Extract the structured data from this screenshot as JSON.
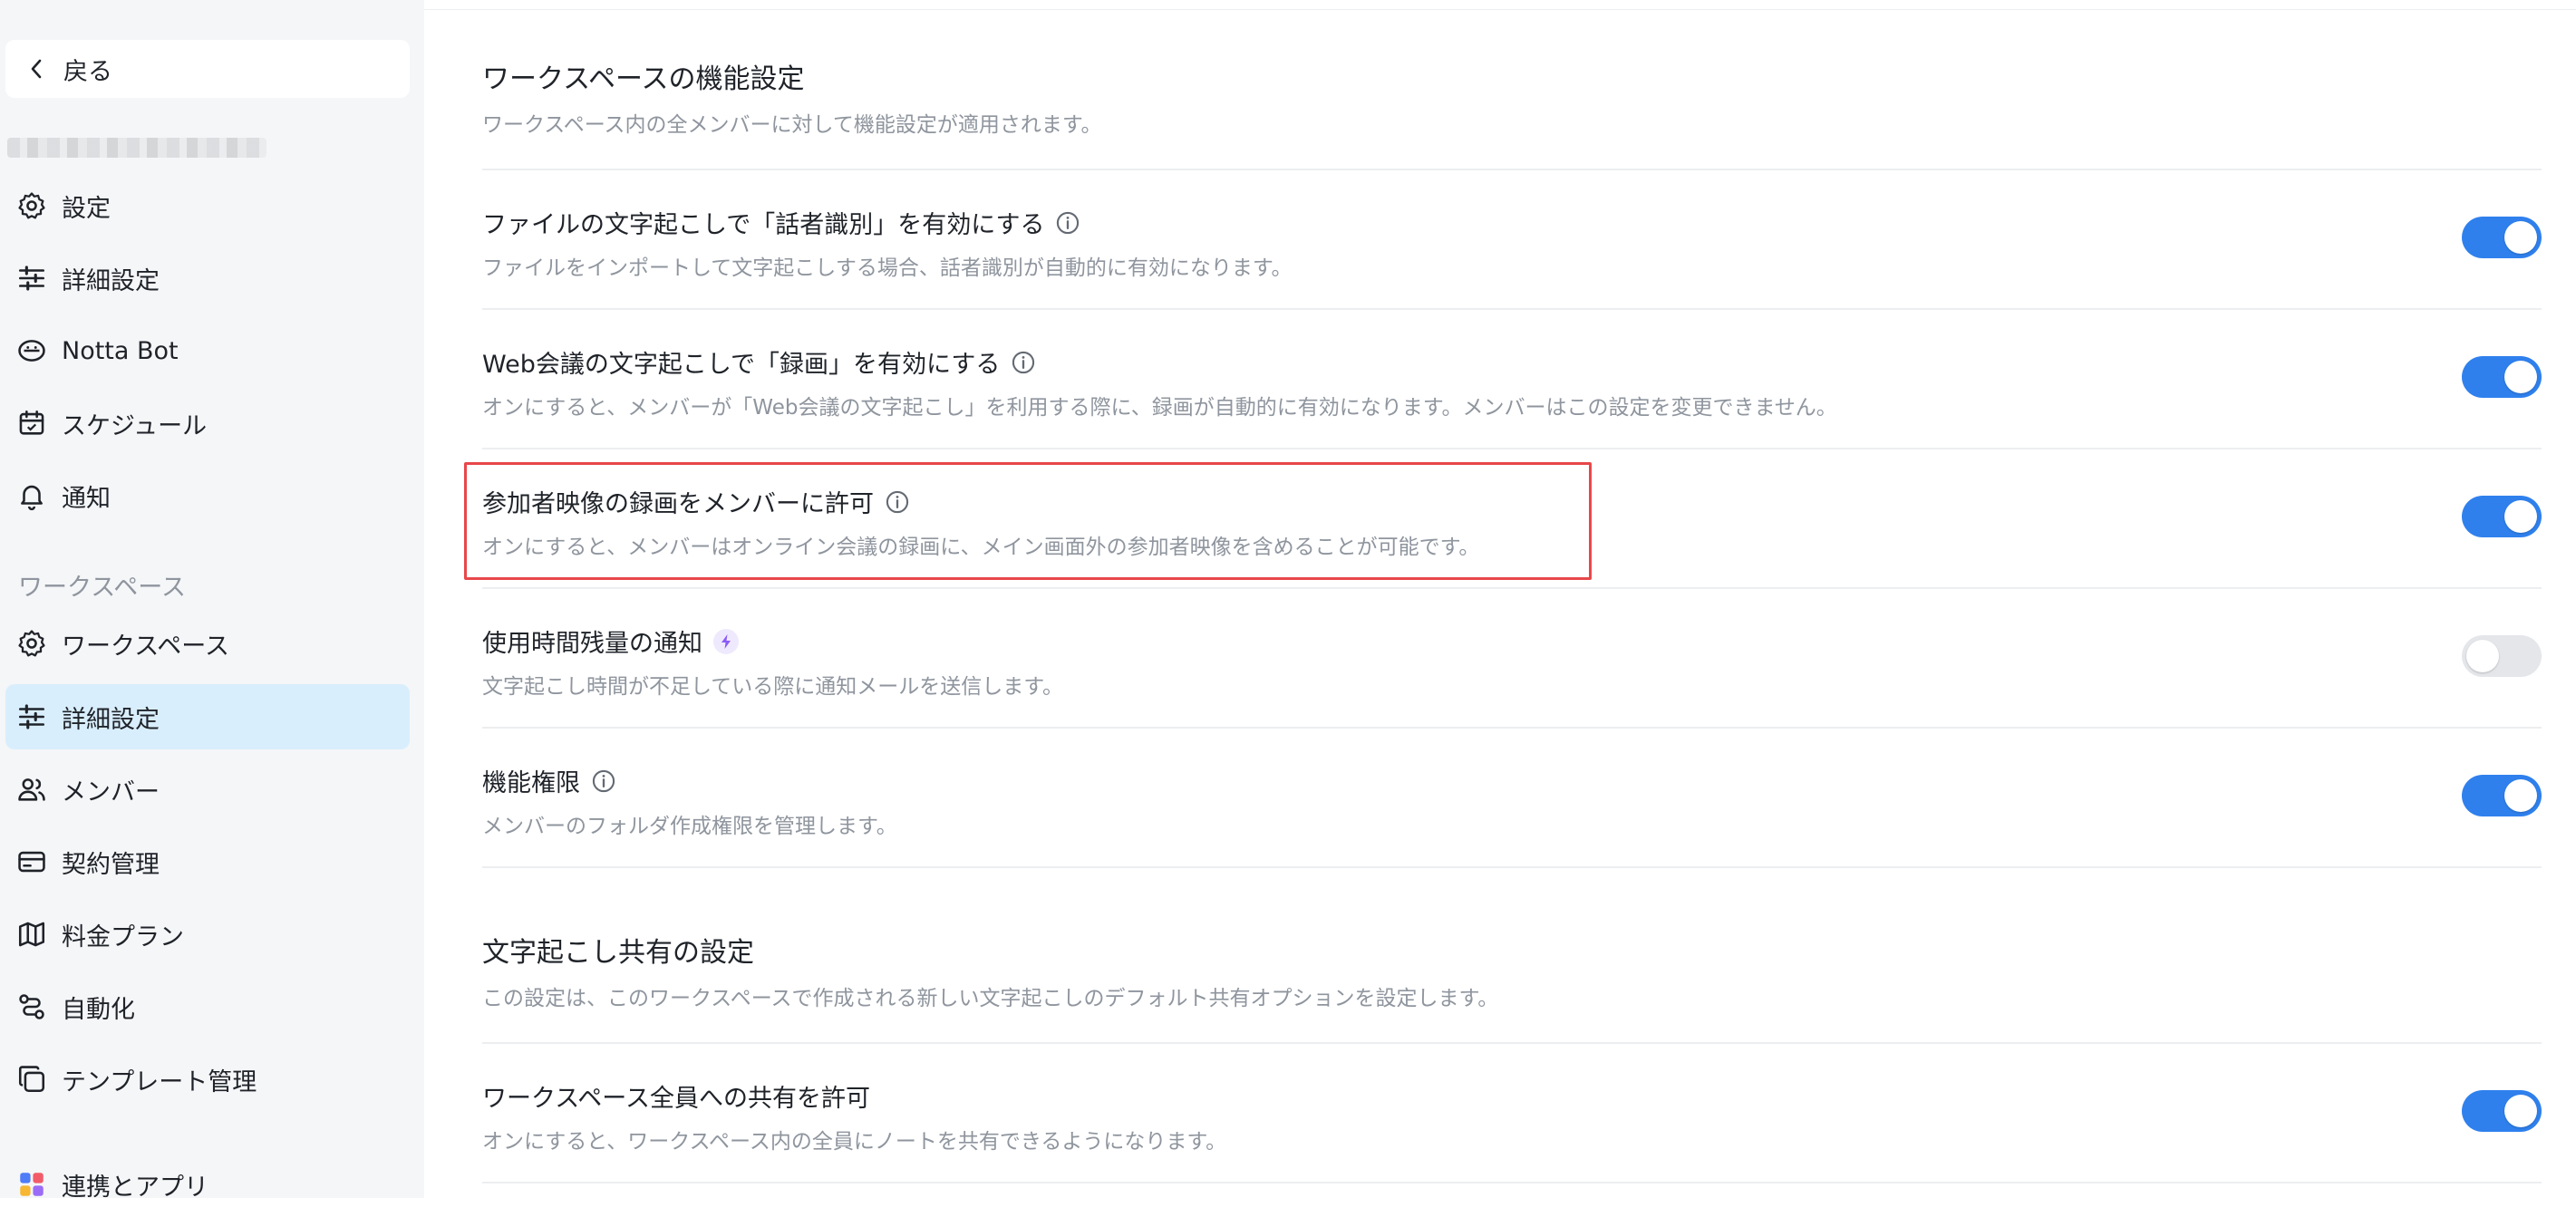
{
  "sidebar": {
    "back_label": "戻る",
    "items_top": [
      {
        "label": "設定",
        "icon": "gear-icon"
      },
      {
        "label": "詳細設定",
        "icon": "sliders-icon"
      },
      {
        "label": "Notta Bot",
        "icon": "bot-icon"
      },
      {
        "label": "スケジュール",
        "icon": "calendar-icon"
      },
      {
        "label": "通知",
        "icon": "bell-icon"
      }
    ],
    "section_label": "ワークスペース",
    "items_workspace": [
      {
        "label": "ワークスペース",
        "icon": "gear-icon"
      },
      {
        "label": "詳細設定",
        "icon": "sliders-icon",
        "active": true
      },
      {
        "label": "メンバー",
        "icon": "users-icon"
      },
      {
        "label": "契約管理",
        "icon": "card-icon"
      },
      {
        "label": "料金プラン",
        "icon": "map-icon"
      },
      {
        "label": "自動化",
        "icon": "automation-icon"
      },
      {
        "label": "テンプレート管理",
        "icon": "template-icon"
      },
      {
        "label": "連携とアプリ",
        "icon": "apps-icon"
      }
    ]
  },
  "feature_section": {
    "title": "ワークスペースの機能設定",
    "desc": "ワークスペース内の全メンバーに対して機能設定が適用されます。",
    "rows": [
      {
        "title": "ファイルの文字起こしで「話者識別」を有効にする",
        "desc": "ファイルをインポートして文字起こしする場合、話者識別が自動的に有効になります。",
        "enabled": true
      },
      {
        "title": "Web会議の文字起こしで「録画」を有効にする",
        "desc": "オンにすると、メンバーが「Web会議の文字起こし」を利用する際に、録画が自動的に有効になります。メンバーはこの設定を変更できません。",
        "enabled": true
      },
      {
        "title": "参加者映像の録画をメンバーに許可",
        "desc": "オンにすると、メンバーはオンライン会議の録画に、メイン画面外の参加者映像を含めることが可能です。",
        "enabled": true
      },
      {
        "title": "使用時間残量の通知",
        "desc": "文字起こし時間が不足している際に通知メールを送信します。",
        "enabled": false
      },
      {
        "title": "機能権限",
        "desc": "メンバーのフォルダ作成権限を管理します。",
        "enabled": true
      }
    ]
  },
  "share_section": {
    "title": "文字起こし共有の設定",
    "desc": "この設定は、このワークスペースで作成される新しい文字起こしのデフォルト共有オプションを設定します。",
    "rows": [
      {
        "title": "ワークスペース全員への共有を許可",
        "desc": "オンにすると、ワークスペース内の全員にノートを共有できるようになります。",
        "enabled": true
      }
    ]
  },
  "colors": {
    "accent": "#2f80ed",
    "active_nav": "#d9eefc",
    "highlight": "#e8474a"
  }
}
